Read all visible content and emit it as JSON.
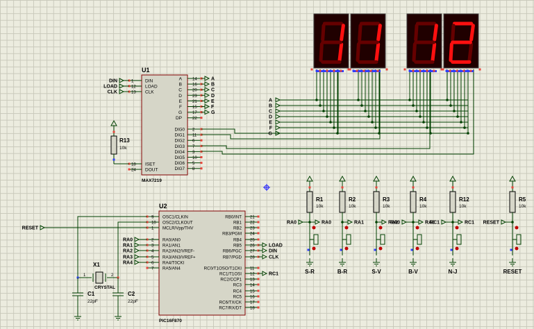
{
  "u1": {
    "ref": "U1",
    "part": "MAX7219",
    "left_pins": [
      {
        "pin": "1",
        "name": "DIN",
        "label": "DIN"
      },
      {
        "pin": "12",
        "name": "LOAD",
        "label": "LOAD"
      },
      {
        "pin": "13",
        "name": "CLK",
        "label": "CLK"
      }
    ],
    "iset": {
      "pin": "18",
      "name": "ISET"
    },
    "dout": {
      "pin": "24",
      "name": "DOUT"
    },
    "seg_pins": [
      {
        "pin": "14",
        "name": "A",
        "label": "A"
      },
      {
        "pin": "16",
        "name": "B",
        "label": "B"
      },
      {
        "pin": "20",
        "name": "C",
        "label": "C"
      },
      {
        "pin": "23",
        "name": "D",
        "label": "D"
      },
      {
        "pin": "21",
        "name": "E",
        "label": "E"
      },
      {
        "pin": "15",
        "name": "F",
        "label": "F"
      },
      {
        "pin": "17",
        "name": "G",
        "label": "G"
      },
      {
        "pin": "22",
        "name": "DP",
        "label": ""
      }
    ],
    "dig_pins": [
      {
        "pin": "2",
        "name": "DIG0"
      },
      {
        "pin": "11",
        "name": "DIG1"
      },
      {
        "pin": "6",
        "name": "DIG2"
      },
      {
        "pin": "7",
        "name": "DIG3"
      },
      {
        "pin": "3",
        "name": "DIG4"
      },
      {
        "pin": "10",
        "name": "DIG5"
      },
      {
        "pin": "5",
        "name": "DIG6"
      },
      {
        "pin": "8",
        "name": "DIG7"
      }
    ]
  },
  "u2": {
    "ref": "U2",
    "part": "PIC16F870",
    "left_pins": [
      {
        "pin": "9",
        "name": "OSC1/CLKIN",
        "label": ""
      },
      {
        "pin": "10",
        "name": "OSC2/CLKOUT",
        "label": ""
      },
      {
        "pin": "1",
        "name": "MCLR/Vpp/THV",
        "label": "RESET"
      },
      {
        "pin": "2",
        "name": "RA0/AN0",
        "label": "RA0"
      },
      {
        "pin": "3",
        "name": "RA1/AN1",
        "label": "RA1"
      },
      {
        "pin": "4",
        "name": "RA2/AN2/VREF-",
        "label": "RA2"
      },
      {
        "pin": "5",
        "name": "RA3/AN3/VREF+",
        "label": "RA3"
      },
      {
        "pin": "6",
        "name": "RA4/T0CKI",
        "label": "RA4"
      },
      {
        "pin": "7",
        "name": "RA5/AN4",
        "label": ""
      }
    ],
    "right_pins_b": [
      {
        "pin": "21",
        "name": "RB0/INT",
        "label": ""
      },
      {
        "pin": "22",
        "name": "RB1",
        "label": ""
      },
      {
        "pin": "23",
        "name": "RB2",
        "label": ""
      },
      {
        "pin": "24",
        "name": "RB3/PGM",
        "label": ""
      },
      {
        "pin": "25",
        "name": "RB4",
        "label": ""
      },
      {
        "pin": "26",
        "name": "RB5",
        "label": "LOAD"
      },
      {
        "pin": "27",
        "name": "RB6/PGC",
        "label": "DIN"
      },
      {
        "pin": "28",
        "name": "RB7/PGD",
        "label": "CLK"
      }
    ],
    "right_pins_c": [
      {
        "pin": "11",
        "name": "RC0/T1OSO/T1CKI",
        "label": ""
      },
      {
        "pin": "12",
        "name": "RC1/T1OSI",
        "label": "RC1"
      },
      {
        "pin": "13",
        "name": "RC2/CCP1",
        "label": ""
      },
      {
        "pin": "14",
        "name": "RC3",
        "label": ""
      },
      {
        "pin": "15",
        "name": "RC4",
        "label": ""
      },
      {
        "pin": "16",
        "name": "RC5",
        "label": ""
      },
      {
        "pin": "17",
        "name": "RC6/TX/CK",
        "label": ""
      },
      {
        "pin": "18",
        "name": "RC7/RX/DT",
        "label": ""
      }
    ]
  },
  "r13": {
    "ref": "R13",
    "value": "10k"
  },
  "crystal": {
    "ref": "X1",
    "label": "CRYSTAL",
    "pin1": "1",
    "pin2": "2"
  },
  "capacitors": [
    {
      "ref": "C1",
      "value": "22pF"
    },
    {
      "ref": "C2",
      "value": "22pF"
    }
  ],
  "segment_bus_labels": [
    "A",
    "B",
    "C",
    "D",
    "E",
    "F",
    "G"
  ],
  "displays": [
    {
      "digits": "11"
    },
    {
      "digits": "12"
    }
  ],
  "buttons": [
    {
      "res": "R1",
      "val": "10k",
      "net": "RA0",
      "left_label": "RA0",
      "name": "S-R"
    },
    {
      "res": "R2",
      "val": "10k",
      "net": "RA1",
      "left_label": "",
      "name": "B-R"
    },
    {
      "res": "R3",
      "val": "10k",
      "net": "RA2",
      "left_label": "",
      "name": "S-V"
    },
    {
      "res": "R4",
      "val": "10k",
      "net": "RA0",
      "left_label": "RA0",
      "name": "B-V"
    },
    {
      "res": "R12",
      "val": "10k",
      "net": "RC1",
      "left_label": "RC1",
      "name": "N-J"
    },
    {
      "res": "R5",
      "val": "10k",
      "net": "",
      "left_label": "RESET",
      "name": "RESET"
    }
  ],
  "colors": {
    "wire": "#004000",
    "chip_fill": "#d6d6c8",
    "chip_stroke": "#800000",
    "pin_red": "#e8453c",
    "pin_blue": "#2f3fff",
    "seg_on": "#ff1010",
    "seg_off": "#660000",
    "display_bg": "#200000",
    "button_label": "#8b0000"
  }
}
